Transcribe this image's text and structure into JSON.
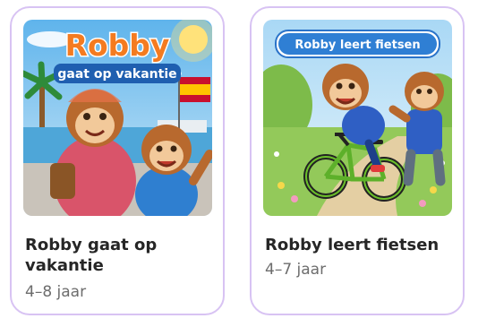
{
  "books": [
    {
      "cover_heading": "Robby",
      "cover_subheading": "gaat op vakantie",
      "title": "Robby gaat op vakantie",
      "age": "4–8 jaar"
    },
    {
      "cover_heading": "Robby leert fietsen",
      "title": "Robby leert fietsen",
      "age": "4–7 jaar"
    }
  ],
  "colors": {
    "card_border": "#d8c3f3",
    "title_text": "#262626",
    "age_text": "#6d6d6d",
    "cover_title_orange": "#f47b20",
    "cover_ribbon_blue": "#1f5fb0"
  }
}
